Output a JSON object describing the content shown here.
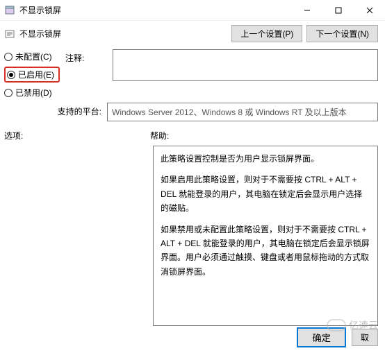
{
  "window": {
    "title": "不显示锁屏"
  },
  "header": {
    "title": "不显示锁屏",
    "prev_btn": "上一个设置(P)",
    "next_btn": "下一个设置(N)"
  },
  "radios": {
    "not_configured": "未配置(C)",
    "enabled": "已启用(E)",
    "disabled": "已禁用(D)",
    "selected": "enabled"
  },
  "comment": {
    "label": "注释:",
    "value": ""
  },
  "platform": {
    "label": "支持的平台:",
    "value": "Windows Server 2012、Windows 8 或 Windows RT 及以上版本"
  },
  "options": {
    "label": "选项:"
  },
  "help": {
    "label": "帮助:",
    "p1": "此策略设置控制是否为用户显示锁屏界面。",
    "p2": "如果启用此策略设置，则对于不需要按 CTRL + ALT + DEL 就能登录的用户，其电脑在锁定后会显示用户选择的磁贴。",
    "p3": "如果禁用或未配置此策略设置，则对于不需要按 CTRL + ALT + DEL 就能登录的用户，其电脑在锁定后会显示锁屏界面。用户必须通过触摸、键盘或者用鼠标拖动的方式取消锁屏界面。"
  },
  "footer": {
    "ok": "确定",
    "cancel": "取"
  },
  "watermark": "亿速云"
}
